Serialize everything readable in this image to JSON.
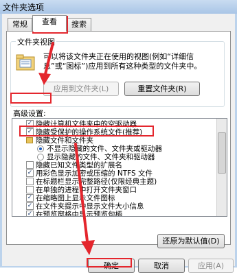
{
  "window": {
    "title": "文件夹选项"
  },
  "tabs": [
    {
      "label": "常规"
    },
    {
      "label": "查看"
    },
    {
      "label": "搜索"
    }
  ],
  "folder_views": {
    "group_label": "文件夹视图",
    "description": "可以将该文件夹正在使用的视图(例如“详细信息”或“图标”)应用到所有这种类型的文件夹中。",
    "apply_button": "应用到文件夹(L)",
    "reset_button": "重置文件夹(R)"
  },
  "advanced": {
    "label": "高级设置:",
    "items": [
      {
        "type": "checkbox",
        "checked": true,
        "label": "隐藏计算机文件夹中的空驱动器"
      },
      {
        "type": "checkbox",
        "checked": true,
        "label": "隐藏受保护的操作系统文件(推荐)"
      },
      {
        "type": "folder",
        "label": "隐藏文件和文件夹"
      },
      {
        "type": "radio",
        "checked": true,
        "label": "不显示隐藏的文件、文件夹或驱动器"
      },
      {
        "type": "radio",
        "checked": false,
        "label": "显示隐藏的文件、文件夹和驱动器"
      },
      {
        "type": "checkbox",
        "checked": false,
        "label": "隐藏已知文件类型的扩展名"
      },
      {
        "type": "checkbox",
        "checked": true,
        "label": "用彩色显示加密或压缩的 NTFS 文件"
      },
      {
        "type": "checkbox",
        "checked": false,
        "label": "在标题栏显示完整路径(仅限经典主题)"
      },
      {
        "type": "checkbox",
        "checked": false,
        "label": "在单独的进程中打开文件夹窗口"
      },
      {
        "type": "checkbox",
        "checked": true,
        "label": "在缩略图上显示文件图标"
      },
      {
        "type": "checkbox",
        "checked": true,
        "label": "在文件夹提示中显示文件大小信息"
      },
      {
        "type": "checkbox",
        "checked": true,
        "label": "在预览窗格中显示预览句柄"
      }
    ],
    "restore_button": "还原为默认值(D)"
  },
  "footer": {
    "ok": "确定",
    "cancel": "取消",
    "apply": "应用(A)"
  },
  "annotation_color": "#e4262d"
}
